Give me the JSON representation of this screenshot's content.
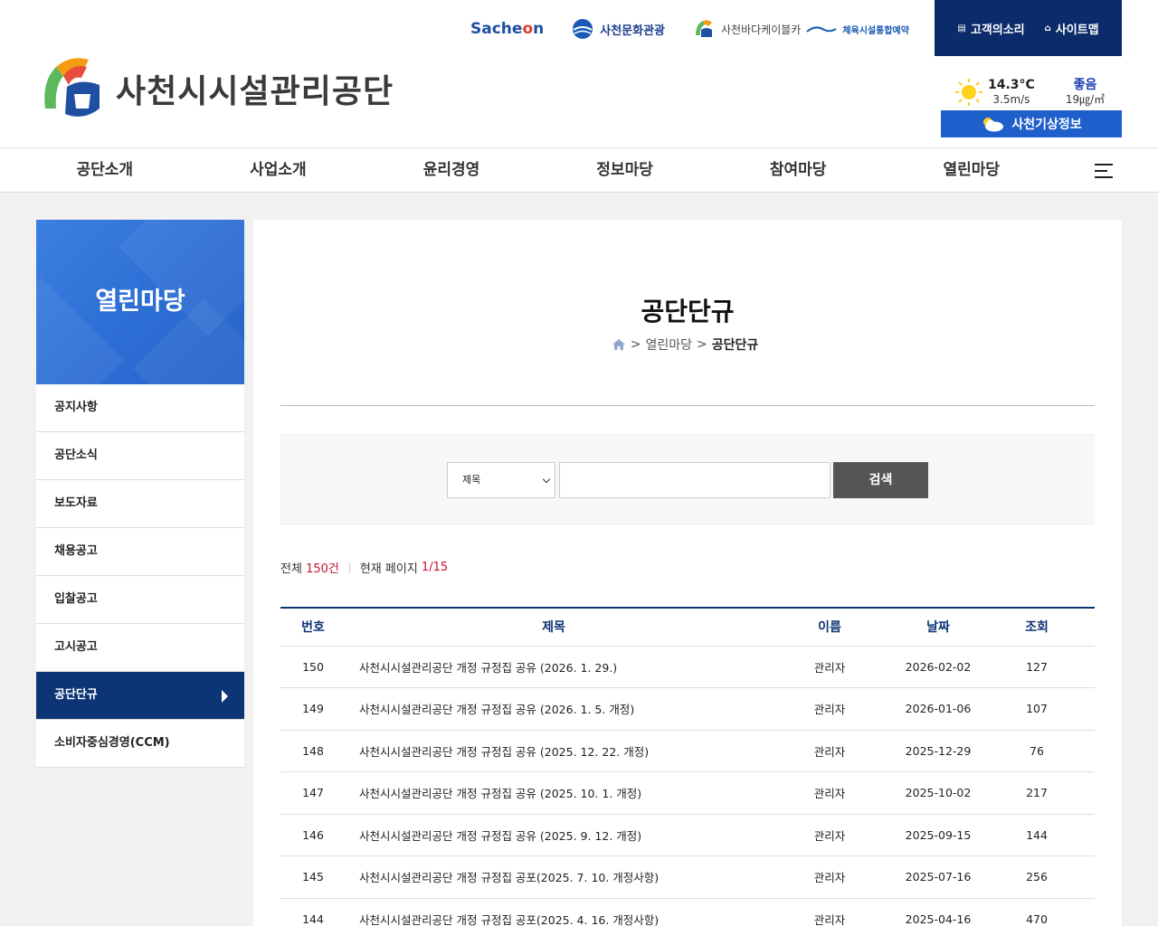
{
  "header": {
    "logo_text": "사천시시설관리공단",
    "partners": {
      "sachon": {
        "pre": "Sache",
        "o": "o",
        "post": "n"
      },
      "culture": "사천문화관광",
      "cable": "사천바다케이블카",
      "sports": "체육시설통합예약"
    },
    "util": {
      "voice": "고객의소리",
      "sitemap": "사이트맵"
    },
    "weather": {
      "temp": "14.3°C",
      "wind": "3.5m/s",
      "air_grade": "좋음",
      "air_value": "19㎍/㎥",
      "link": "사천기상정보"
    }
  },
  "gnb": [
    "공단소개",
    "사업소개",
    "윤리경영",
    "정보마당",
    "참여마당",
    "열린마당"
  ],
  "side": {
    "title": "열린마당",
    "items": [
      "공지사항",
      "공단소식",
      "보도자료",
      "채용공고",
      "입찰공고",
      "고시공고",
      "공단단규",
      "소비자중심경영(CCM)"
    ]
  },
  "content": {
    "title": "공단단규",
    "breadcrumb": {
      "sep1": ">",
      "section": "열린마당",
      "sep2": ">",
      "current": "공단단규"
    },
    "search": {
      "select": "제목",
      "input_value": "",
      "button": "검색"
    },
    "summary": {
      "total_label": "전체",
      "total": "150건",
      "page_label": "현재 페이지",
      "page": "1/15"
    },
    "table": {
      "headers": [
        "번호",
        "제목",
        "이름",
        "날짜",
        "조회"
      ],
      "rows": [
        [
          "150",
          "사천시시설관리공단 개정 규정집 공유 (2026. 1. 29.)",
          "관리자",
          "2026-02-02",
          "127"
        ],
        [
          "149",
          "사천시시설관리공단 개정 규정집 공유 (2026. 1. 5. 개정)",
          "관리자",
          "2026-01-06",
          "107"
        ],
        [
          "148",
          "사천시시설관리공단 개정 규정집 공유 (2025. 12. 22. 개정)",
          "관리자",
          "2025-12-29",
          "76"
        ],
        [
          "147",
          "사천시시설관리공단 개정 규정집 공유 (2025. 10. 1. 개정)",
          "관리자",
          "2025-10-02",
          "217"
        ],
        [
          "146",
          "사천시시설관리공단 개정 규정집 공유 (2025. 9. 12. 개정)",
          "관리자",
          "2025-09-15",
          "144"
        ],
        [
          "145",
          "사천시시설관리공단 개정 규정집 공포(2025. 7. 10. 개정사항)",
          "관리자",
          "2025-07-16",
          "256"
        ],
        [
          "144",
          "사천시시설관리공단 개정 규정집 공포(2025. 4. 16. 개정사항)",
          "관리자",
          "2025-04-16",
          "470"
        ]
      ]
    }
  }
}
